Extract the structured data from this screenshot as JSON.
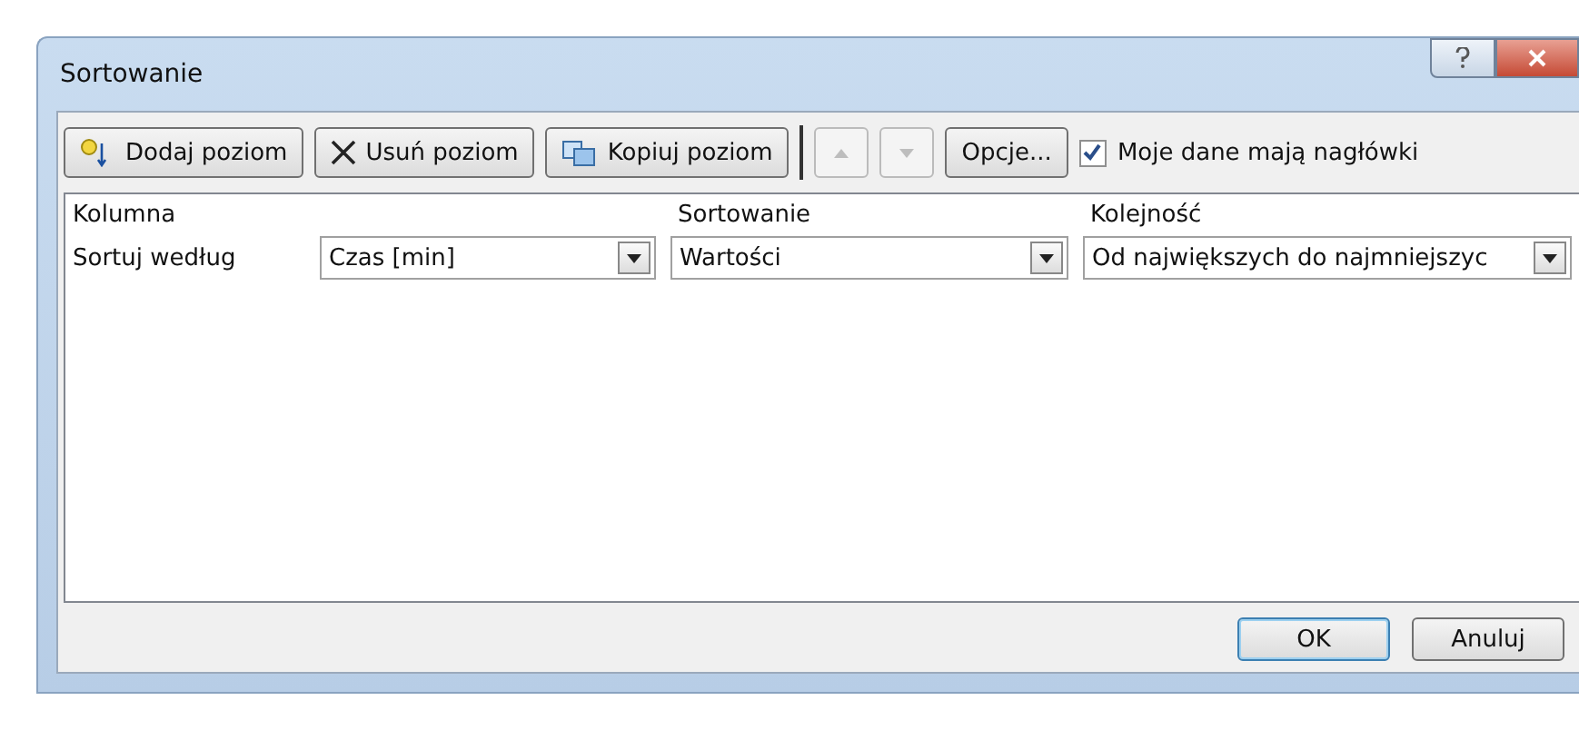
{
  "window": {
    "title": "Sortowanie"
  },
  "toolbar": {
    "buttons": [
      {
        "label": "Dodaj poziom",
        "kind": "add"
      },
      {
        "label": "Usuń poziom",
        "kind": "delete"
      },
      {
        "label": "Kopiuj poziom",
        "kind": "copy"
      }
    ],
    "move_up": {
      "disabled": true
    },
    "move_down": {
      "disabled": true
    },
    "options_button": "Opcje...",
    "headers_checkbox": {
      "label": "Moje dane mają nagłówki",
      "checked": true
    }
  },
  "table": {
    "columns": [
      "Kolumna",
      "Sortowanie",
      "Kolejność"
    ],
    "rows": [
      {
        "label": "Sortuj według",
        "column": "Czas [min]",
        "sort_on": "Wartości",
        "order": "Od największych do najmniejszyc"
      }
    ]
  },
  "buttons": [
    {
      "label": "OK",
      "kind": "default"
    },
    {
      "label": "Anuluj",
      "kind": "normal"
    }
  ]
}
